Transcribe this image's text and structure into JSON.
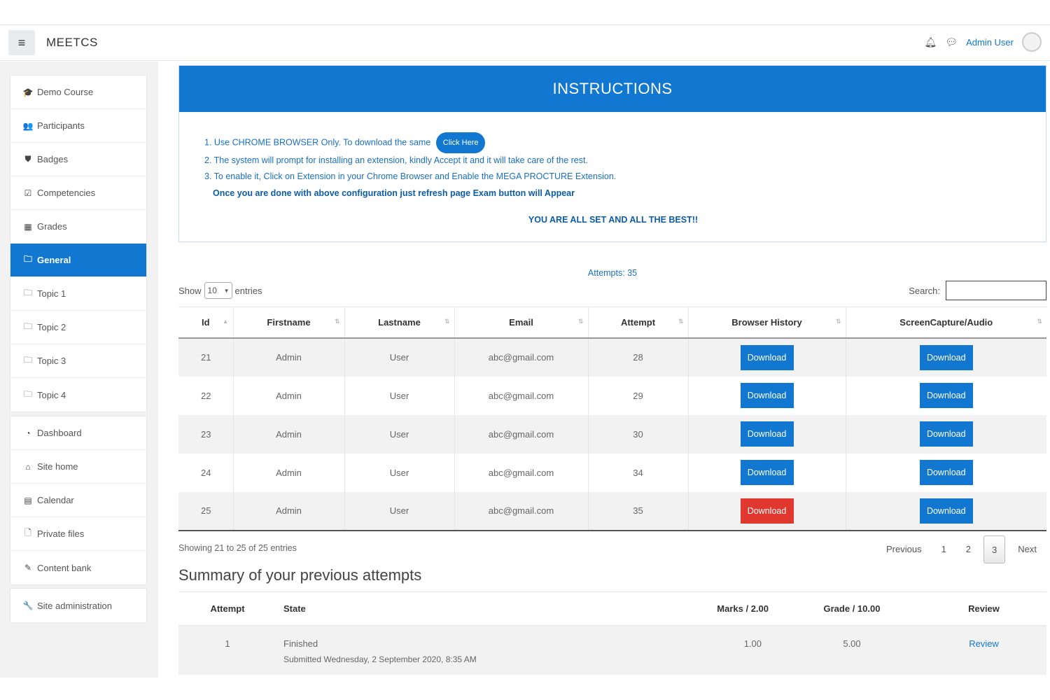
{
  "header": {
    "site_name": "MEETCS",
    "menu_icon": "hamburger-icon",
    "user_name": "Admin User"
  },
  "sidebar": {
    "group1": [
      {
        "icon": "graduation-cap-icon",
        "glyph": "🎓",
        "label": "Demo Course"
      },
      {
        "icon": "users-icon",
        "glyph": "👥",
        "label": "Participants"
      },
      {
        "icon": "shield-icon",
        "glyph": "⛊",
        "label": "Badges"
      },
      {
        "icon": "check-square-icon",
        "glyph": "☑",
        "label": "Competencies"
      },
      {
        "icon": "table-icon",
        "glyph": "▦",
        "label": "Grades"
      },
      {
        "icon": "folder-icon",
        "glyph": "🗀",
        "label": "General",
        "active": true
      },
      {
        "icon": "folder-icon",
        "glyph": "🗀",
        "label": "Topic 1"
      },
      {
        "icon": "folder-icon",
        "glyph": "🗀",
        "label": "Topic 2"
      },
      {
        "icon": "folder-icon",
        "glyph": "🗀",
        "label": "Topic 3"
      },
      {
        "icon": "folder-icon",
        "glyph": "🗀",
        "label": "Topic 4"
      }
    ],
    "group2": [
      {
        "icon": "dashboard-icon",
        "glyph": "◔",
        "label": "Dashboard"
      },
      {
        "icon": "home-icon",
        "glyph": "⌂",
        "label": "Site home"
      },
      {
        "icon": "calendar-icon",
        "glyph": "▤",
        "label": "Calendar"
      },
      {
        "icon": "file-icon",
        "glyph": "🗋",
        "label": "Private files"
      },
      {
        "icon": "pencil-icon",
        "glyph": "✎",
        "label": "Content bank"
      }
    ],
    "group3": [
      {
        "icon": "wrench-icon",
        "glyph": "🔧",
        "label": "Site administration"
      }
    ]
  },
  "instructions": {
    "title": "INSTRUCTIONS",
    "line1": "1. Use CHROME BROWSER Only. To download the same",
    "click_here": "Click Here",
    "line2": "2. The system will prompt for installing an extension, kindly Accept it and it will take care of the rest.",
    "line3": "3. To enable it, Click on Extension in your Chrome Browser and Enable the MEGA PROCTURE Extension.",
    "bold_line": "Once you are done with above configuration just refresh page Exam button will Appear",
    "all_set": "YOU ARE ALL SET AND ALL THE BEST!!"
  },
  "attempts_label": "Attempts: 35",
  "table_controls": {
    "show": "Show",
    "entries_value": "10",
    "entries": "entries",
    "search_label": "Search:"
  },
  "attempts_table": {
    "columns": [
      "Id",
      "Firstname",
      "Lastname",
      "Email",
      "Attempt",
      "Browser History",
      "ScreenCapture/Audio"
    ],
    "rows": [
      {
        "id": "21",
        "first": "Admin",
        "last": "User",
        "email": "abc@gmail.com",
        "attempt": "28",
        "bh": "Download",
        "sc": "Download",
        "bh_color": "#1177d1"
      },
      {
        "id": "22",
        "first": "Admin",
        "last": "User",
        "email": "abc@gmail.com",
        "attempt": "29",
        "bh": "Download",
        "sc": "Download",
        "bh_color": "#1177d1"
      },
      {
        "id": "23",
        "first": "Admin",
        "last": "User",
        "email": "abc@gmail.com",
        "attempt": "30",
        "bh": "Download",
        "sc": "Download",
        "bh_color": "#1177d1"
      },
      {
        "id": "24",
        "first": "Admin",
        "last": "User",
        "email": "abc@gmail.com",
        "attempt": "34",
        "bh": "Download",
        "sc": "Download",
        "bh_color": "#1177d1"
      },
      {
        "id": "25",
        "first": "Admin",
        "last": "User",
        "email": "abc@gmail.com",
        "attempt": "35",
        "bh": "Download",
        "sc": "Download",
        "bh_color": "#e0382f"
      }
    ]
  },
  "table_info": "Showing 21 to 25 of 25 entries",
  "pagination": {
    "previous": "Previous",
    "pages": [
      "1",
      "2",
      "3"
    ],
    "current": "3",
    "next": "Next"
  },
  "summary": {
    "title": "Summary of your previous attempts",
    "columns": [
      "Attempt",
      "State",
      "Marks / 2.00",
      "Grade / 10.00",
      "Review"
    ],
    "row": {
      "attempt": "1",
      "state": "Finished",
      "submitted": "Submitted Wednesday, 2 September 2020, 8:35 AM",
      "marks": "1.00",
      "grade": "5.00",
      "review": "Review"
    }
  }
}
